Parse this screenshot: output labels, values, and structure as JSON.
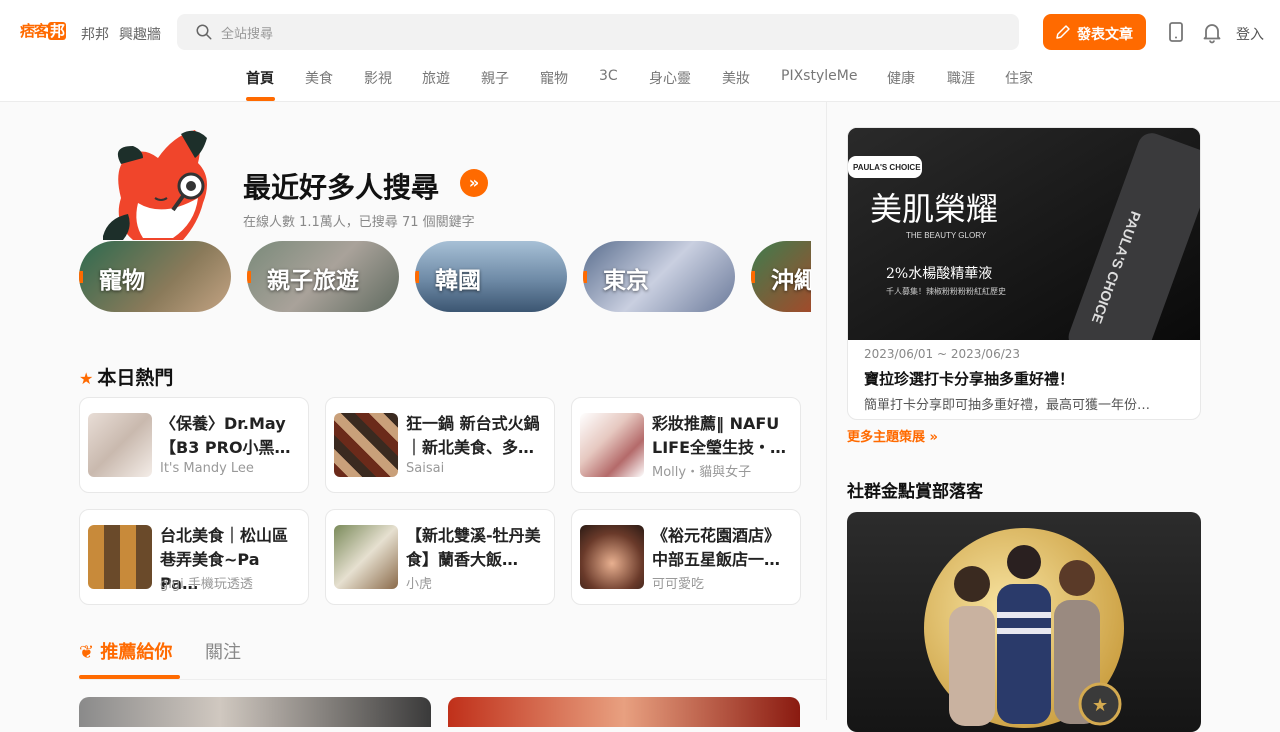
{
  "brand": {
    "logo_a": "痞客",
    "logo_b": "邦",
    "accent": "#ff6a00"
  },
  "header": {
    "links": [
      "邦邦",
      "興趣牆"
    ],
    "search_placeholder": "全站搜尋",
    "post_button": "發表文章",
    "login": "登入"
  },
  "nav": {
    "tabs": [
      "首頁",
      "美食",
      "影視",
      "旅遊",
      "親子",
      "寵物",
      "3C",
      "身心靈",
      "美妝",
      "PIXstyleMe",
      "健康",
      "職涯",
      "住家"
    ],
    "active": "首頁"
  },
  "trending": {
    "title": "最近好多人搜尋",
    "subtitle": "在線人數 1.1萬人，已搜尋 71 個關鍵字",
    "keywords": [
      "寵物",
      "親子旅遊",
      "韓國",
      "東京",
      "沖繩"
    ]
  },
  "today_hot": {
    "title": "本日熱門",
    "items": [
      {
        "title": "〈保養〉Dr.May【B3 PRO小黑…",
        "author": "It's Mandy Lee"
      },
      {
        "title": "狂一鍋 新台式火鍋｜新北美食、多…",
        "author": "Saisai"
      },
      {
        "title": "彩妝推薦‖ NAFU LIFE全瑩生技・…",
        "author": "Molly・貓與女子"
      },
      {
        "title": "台北美食｜松山區巷弄美食~Pa Pa…",
        "author": "gigi 手機玩透透"
      },
      {
        "title": "【新北雙溪-牡丹美食】蘭香大飯…",
        "author": "小虎"
      },
      {
        "title": "《裕元花園酒店》中部五星飯店一…",
        "author": "可可愛吃"
      }
    ]
  },
  "feed_tabs": {
    "recommend": "推薦給你",
    "follow": "關注"
  },
  "sidebar": {
    "ad": {
      "brand_tag": "PAULA'S CHOICE",
      "headline": "美肌榮耀",
      "headline_en": "THE BEAUTY GLORY",
      "product": "2%水楊酸精華液",
      "product_sub": "千人募集！辣椒粉粉粉粉紅紅歷史",
      "bottle_text": "PAULA'S CHOICE",
      "date": "2023/06/01 ~ 2023/06/23",
      "title": "寶拉珍選打卡分享抽多重好禮！",
      "desc": "簡單打卡分享即可抽多重好禮，最高可獲一年份…"
    },
    "more": "更多主題策展",
    "section_title": "社群金點賞部落客"
  }
}
